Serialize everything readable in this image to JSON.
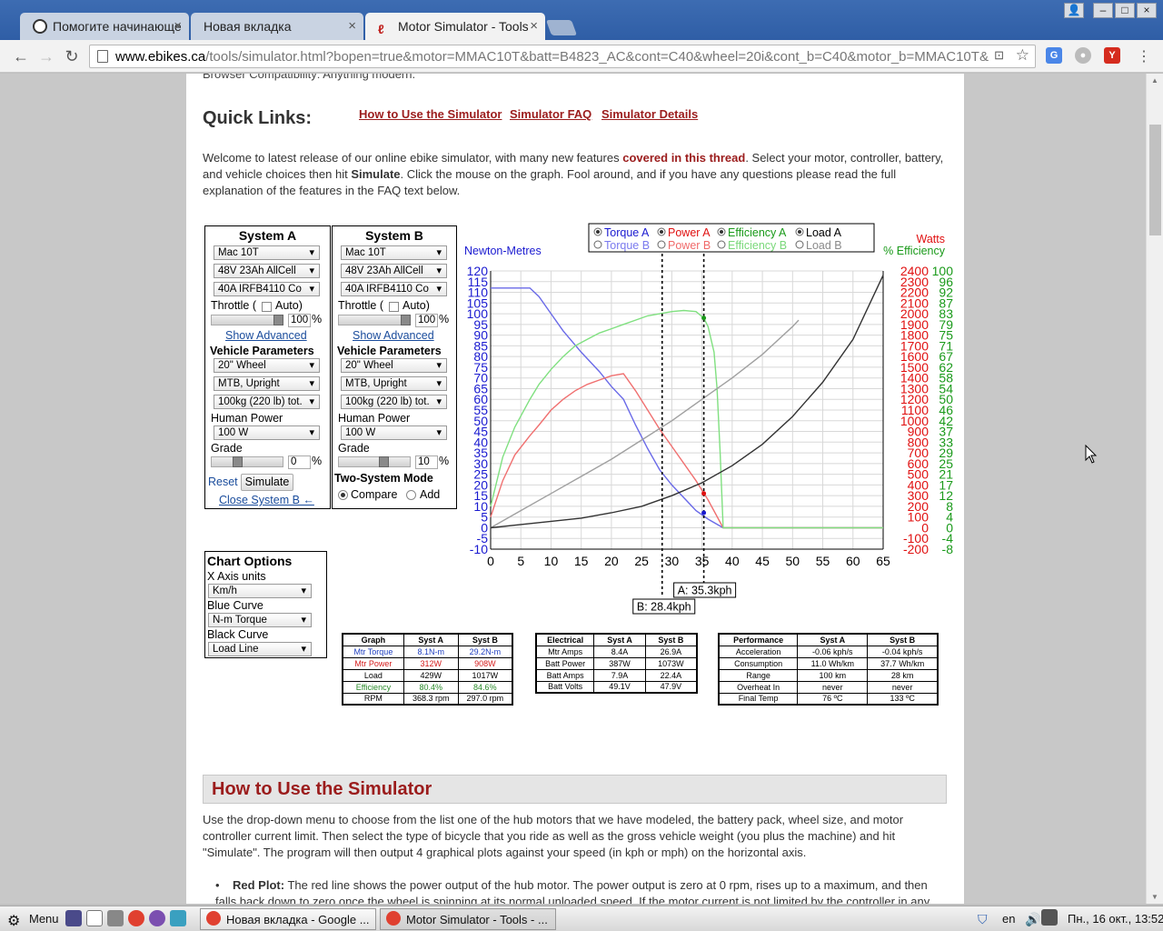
{
  "browser": {
    "tabs": [
      {
        "title": "Помогите начинающе"
      },
      {
        "title": "Новая вкладка"
      },
      {
        "title": "Motor Simulator - Tools"
      }
    ],
    "url_host": "www.ebikes.ca",
    "url_path": "/tools/simulator.html?bopen=true&motor=MMAC10T&batt=B4823_AC&cont=C40&wheel=20i&cont_b=C40&motor_b=MMAC10T&"
  },
  "page": {
    "cut_text": "Browser Compatibility: Anything modern.",
    "quick_links_title": "Quick Links:",
    "quick_links": [
      "How to Use the Simulator",
      "Simulator FAQ",
      "Simulator Details"
    ],
    "intro_1": "Welcome to latest release of our online ebike simulator, with many new features ",
    "intro_link": "covered in this thread",
    "intro_2": ".  Select your motor, controller, battery, and vehicle choices then hit ",
    "intro_bold": "Simulate",
    "intro_3": ". Click the mouse on the graph. Fool around, and if you have any questions please read the full explanation of the features in the FAQ text below.",
    "system_a": {
      "title": "System A",
      "motor": "Mac 10T",
      "battery": "48V 23Ah AllCell",
      "controller": "40A IRFB4110 Co",
      "throttle_label": "Throttle (",
      "auto_label": "Auto)",
      "throttle_value": "100",
      "pct": "%",
      "show_advanced": "Show Advanced",
      "vehicle_params": "Vehicle Parameters",
      "wheel": "20\"  Wheel",
      "frame": "MTB, Upright",
      "weight": "100kg (220 lb) tot.",
      "human_power_label": "Human Power",
      "human_power": "100 W",
      "grade_label": "Grade",
      "grade_value": "0",
      "reset": "Reset",
      "simulate": "Simulate",
      "close_b": "Close System B ←"
    },
    "system_b": {
      "title": "System B",
      "motor": "Mac 10T",
      "battery": "48V 23Ah AllCell",
      "controller": "40A IRFB4110 Co",
      "throttle_label": "Throttle (",
      "auto_label": "Auto)",
      "throttle_value": "100",
      "pct": "%",
      "show_advanced": "Show Advanced",
      "vehicle_params": "Vehicle Parameters",
      "wheel": "20\"  Wheel",
      "frame": "MTB, Upright",
      "weight": "100kg (220 lb) tot.",
      "human_power_label": "Human Power",
      "human_power": "100 W",
      "grade_label": "Grade",
      "grade_value": "10",
      "two_system_mode": "Two-System Mode",
      "compare": "Compare",
      "add": "Add"
    },
    "chart_options": {
      "title": "Chart Options",
      "x_axis_label": "X Axis units",
      "x_axis": "Km/h",
      "blue_label": "Blue Curve",
      "blue": "N-m Torque",
      "black_label": "Black Curve",
      "black": "Load Line"
    },
    "how_to_title": "How to Use the Simulator",
    "how_to_text": "Use the drop-down menu to choose from the list one of the hub motors that we have modeled, the battery pack, wheel size, and motor controller current limit. Then select the type of bicycle that you ride as well as the gross vehicle weight (you plus the machine) and hit \"Simulate\". The program will then output 4 graphical plots against your speed (in kph or mph) on the horizontal axis.",
    "bullet_bold": "Red Plot:",
    "bullet_text": " The red line shows the power output of the hub motor. The power output is zero at 0 rpm, rises up to a maximum, and then falls back down to zero once the wheel is spinning at its normal unloaded speed. If the motor current is not limited by the controller in any way, then"
  },
  "tables": {
    "graph": {
      "headers": [
        "Graph",
        "Syst A",
        "Syst B"
      ],
      "rows": [
        [
          "Mtr Torque",
          "8.1N-m",
          "29.2N-m"
        ],
        [
          "Mtr Power",
          "312W",
          "908W"
        ],
        [
          "Load",
          "429W",
          "1017W"
        ],
        [
          "Efficiency",
          "80.4%",
          "84.6%"
        ],
        [
          "RPM",
          "368.3 rpm",
          "297.0 rpm"
        ]
      ],
      "row_colors": [
        "#1f3fbf",
        "#d41c1c",
        "#000000",
        "#2a8a2a",
        "#000000"
      ]
    },
    "electrical": {
      "headers": [
        "Electrical",
        "Syst A",
        "Syst B"
      ],
      "rows": [
        [
          "Mtr Amps",
          "8.4A",
          "26.9A"
        ],
        [
          "Batt Power",
          "387W",
          "1073W"
        ],
        [
          "Batt Amps",
          "7.9A",
          "22.4A"
        ],
        [
          "Batt Volts",
          "49.1V",
          "47.9V"
        ]
      ]
    },
    "performance": {
      "headers": [
        "Performance",
        "Syst A",
        "Syst B"
      ],
      "rows": [
        [
          "Acceleration",
          "-0.06 kph/s",
          "-0.04 kph/s"
        ],
        [
          "Consumption",
          "11.0 Wh/km",
          "37.7 Wh/km"
        ],
        [
          "Range",
          "100 km",
          "28 km"
        ],
        [
          "Overheat In",
          "never",
          "never"
        ],
        [
          "Final Temp",
          "76 ºC",
          "133 ºC"
        ]
      ]
    }
  },
  "chart_data": {
    "type": "line",
    "left_axis_label": "Newton-Metres",
    "right_axis_label_watts": "Watts",
    "right_axis_label_eff": "% Efficiency",
    "xlim": [
      0,
      65
    ],
    "ylim": [
      -10,
      120
    ],
    "x_ticks": [
      0,
      5,
      10,
      15,
      20,
      25,
      30,
      35,
      40,
      45,
      50,
      55,
      60,
      65
    ],
    "y_ticks_nm": [
      -10,
      -5,
      0,
      5,
      10,
      15,
      20,
      25,
      30,
      35,
      40,
      45,
      50,
      55,
      60,
      65,
      70,
      75,
      80,
      85,
      90,
      95,
      100,
      105,
      110,
      115,
      120
    ],
    "y_ticks_watts": [
      "-200",
      "-100",
      "0",
      "100",
      "200",
      "300",
      "400",
      "500",
      "600",
      "700",
      "800",
      "900",
      "1000",
      "1100",
      "1200",
      "1300",
      "1400",
      "1500",
      "1600",
      "1700",
      "1800",
      "1900",
      "2000",
      "2100",
      "2200",
      "2300",
      "2400"
    ],
    "y_ticks_eff": [
      "-8",
      "-4",
      "0",
      "4",
      "8",
      "12",
      "17",
      "21",
      "25",
      "29",
      "33",
      "37",
      "42",
      "46",
      "50",
      "54",
      "58",
      "62",
      "67",
      "71",
      "75",
      "79",
      "83",
      "87",
      "92",
      "96",
      "100"
    ],
    "legend": [
      {
        "label": "Torque A",
        "color": "#1a1ad0",
        "on": true
      },
      {
        "label": "Power A",
        "color": "#e01010",
        "on": true
      },
      {
        "label": "Efficiency A",
        "color": "#1a9a1a",
        "on": true
      },
      {
        "label": "Load A",
        "color": "#000000",
        "on": true
      },
      {
        "label": "Torque B",
        "color": "#7a7aee",
        "on": false
      },
      {
        "label": "Power B",
        "color": "#f06a6a",
        "on": false
      },
      {
        "label": "Efficiency B",
        "color": "#7ad87a",
        "on": false
      },
      {
        "label": "Load B",
        "color": "#8a8a8a",
        "on": false
      }
    ],
    "series": [
      {
        "name": "Torque B",
        "color": "#6a6ae8",
        "points": [
          [
            0,
            112
          ],
          [
            2,
            112
          ],
          [
            4,
            112
          ],
          [
            6.5,
            112
          ],
          [
            8,
            108
          ],
          [
            10,
            100
          ],
          [
            12,
            92
          ],
          [
            15,
            82
          ],
          [
            18,
            73
          ],
          [
            20,
            66
          ],
          [
            22,
            60
          ],
          [
            24,
            48
          ],
          [
            26,
            37
          ],
          [
            28,
            27
          ],
          [
            30,
            20
          ],
          [
            32,
            14
          ],
          [
            34,
            8
          ],
          [
            36,
            4
          ],
          [
            38.5,
            0
          ],
          [
            65,
            0
          ]
        ]
      },
      {
        "name": "Power B",
        "color": "#f07070",
        "points": [
          [
            0,
            5
          ],
          [
            2,
            22
          ],
          [
            4,
            34
          ],
          [
            6.5,
            43
          ],
          [
            8,
            48
          ],
          [
            10,
            55
          ],
          [
            12,
            60
          ],
          [
            14,
            64
          ],
          [
            16,
            67
          ],
          [
            18,
            69
          ],
          [
            20,
            71
          ],
          [
            22,
            72
          ],
          [
            24,
            64
          ],
          [
            26,
            55
          ],
          [
            28,
            46
          ],
          [
            30,
            38
          ],
          [
            32,
            30
          ],
          [
            34,
            22
          ],
          [
            36,
            13
          ],
          [
            38.5,
            0
          ],
          [
            65,
            0
          ]
        ]
      },
      {
        "name": "Efficiency B",
        "color": "#80e080",
        "points": [
          [
            0,
            10
          ],
          [
            2,
            33
          ],
          [
            4,
            47
          ],
          [
            6.5,
            60
          ],
          [
            8,
            67
          ],
          [
            10,
            74
          ],
          [
            12,
            80
          ],
          [
            14,
            85
          ],
          [
            16,
            88
          ],
          [
            18,
            91
          ],
          [
            20,
            93
          ],
          [
            22,
            95
          ],
          [
            24,
            97
          ],
          [
            26,
            99
          ],
          [
            28,
            100
          ],
          [
            30,
            101
          ],
          [
            32,
            101.5
          ],
          [
            34,
            101
          ],
          [
            35.3,
            98
          ],
          [
            36,
            94
          ],
          [
            37,
            82
          ],
          [
            37.5,
            65
          ],
          [
            38,
            35
          ],
          [
            38.5,
            0
          ],
          [
            65,
            0
          ]
        ]
      },
      {
        "name": "Load B",
        "color": "#a0a0a0",
        "points": [
          [
            0,
            0
          ],
          [
            5,
            8
          ],
          [
            10,
            16
          ],
          [
            15,
            24
          ],
          [
            20,
            32
          ],
          [
            25,
            41
          ],
          [
            30,
            50
          ],
          [
            35,
            60
          ],
          [
            40,
            70
          ],
          [
            45,
            81
          ],
          [
            50,
            94
          ],
          [
            51,
            97
          ]
        ]
      },
      {
        "name": "Load A",
        "color": "#333333",
        "points": [
          [
            0,
            0
          ],
          [
            5,
            1.5
          ],
          [
            10,
            3
          ],
          [
            15,
            4.5
          ],
          [
            20,
            7
          ],
          [
            25,
            10
          ],
          [
            30,
            15
          ],
          [
            35,
            21
          ],
          [
            40,
            29
          ],
          [
            45,
            39
          ],
          [
            50,
            52
          ],
          [
            55,
            68
          ],
          [
            60,
            88
          ],
          [
            65,
            118
          ]
        ]
      }
    ],
    "markers": [
      {
        "label": "A: 35.3kph",
        "x": 35.3
      },
      {
        "label": "B: 28.4kph",
        "x": 28.4
      }
    ],
    "marker_points": [
      {
        "x": 35.3,
        "y": 98,
        "color": "#1a9a1a"
      },
      {
        "x": 35.3,
        "y": 16,
        "color": "#e01010"
      },
      {
        "x": 35.3,
        "y": 7,
        "color": "#1a1ad0"
      }
    ]
  },
  "taskbar": {
    "menu": "Menu",
    "windows": [
      "Новая вкладка - Google ...",
      "Motor Simulator - Tools - ..."
    ],
    "lang": "en",
    "clock": "Пн., 16 окт., 13:52"
  }
}
